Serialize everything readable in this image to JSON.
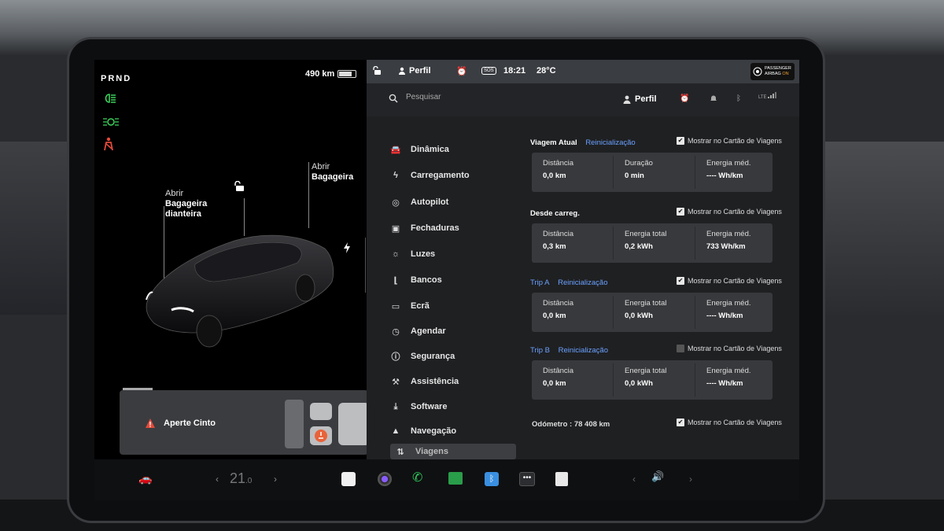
{
  "left": {
    "gear": "PRND",
    "range": "490 km",
    "front_trunk": {
      "action": "Abrir",
      "name": "Bagageira dianteira"
    },
    "rear_trunk": {
      "action": "Abrir",
      "name": "Bagageira"
    },
    "seatbelt_warning": "Aperte Cinto"
  },
  "status": {
    "profile": "Perfil",
    "sos": "SOS",
    "time": "18:21",
    "temperature": "28°C",
    "airbag_line1": "PASSENGER",
    "airbag_line2": "AIRBAG",
    "airbag_state": "ON"
  },
  "search": {
    "placeholder": "Pesquisar"
  },
  "header": {
    "profile": "Perfil",
    "network": "LTE"
  },
  "menu": {
    "items": [
      {
        "label": "Dinâmica",
        "icon": "car-icon"
      },
      {
        "label": "Carregamento",
        "icon": "bolt-icon"
      },
      {
        "label": "Autopilot",
        "icon": "steering-wheel-icon"
      },
      {
        "label": "Fechaduras",
        "icon": "lock-icon"
      },
      {
        "label": "Luzes",
        "icon": "sun-icon"
      },
      {
        "label": "Bancos",
        "icon": "seat-icon"
      },
      {
        "label": "Ecrã",
        "icon": "display-icon"
      },
      {
        "label": "Agendar",
        "icon": "alarm-icon"
      },
      {
        "label": "Segurança",
        "icon": "info-icon"
      },
      {
        "label": "Assistência",
        "icon": "wrench-icon"
      },
      {
        "label": "Software",
        "icon": "download-icon"
      },
      {
        "label": "Navegação",
        "icon": "navigation-icon"
      },
      {
        "label": "Viagens",
        "icon": "trips-icon"
      }
    ]
  },
  "trips": {
    "show_label": "Mostrar no Cartão de Viagens",
    "reset_label": "Reinicialização",
    "current": {
      "title": "Viagem Atual",
      "checked": true,
      "cells": [
        {
          "label": "Distância",
          "value": "0,0  km"
        },
        {
          "label": "Duração",
          "value": "0  min"
        },
        {
          "label": "Energia méd.",
          "value": "----  Wh/km"
        }
      ]
    },
    "since_charge": {
      "title": "Desde carreg.",
      "checked": true,
      "cells": [
        {
          "label": "Distância",
          "value": "0,3  km"
        },
        {
          "label": "Energia total",
          "value": "0,2  kWh"
        },
        {
          "label": "Energia méd.",
          "value": "733  Wh/km"
        }
      ]
    },
    "trip_a": {
      "title": "Trip A",
      "checked": true,
      "cells": [
        {
          "label": "Distância",
          "value": "0,0  km"
        },
        {
          "label": "Energia total",
          "value": "0,0  kWh"
        },
        {
          "label": "Energia méd.",
          "value": "----  Wh/km"
        }
      ]
    },
    "trip_b": {
      "title": "Trip B",
      "checked": false,
      "cells": [
        {
          "label": "Distância",
          "value": "0,0  km"
        },
        {
          "label": "Energia total",
          "value": "0,0  kWh"
        },
        {
          "label": "Energia méd.",
          "value": "----  Wh/km"
        }
      ]
    },
    "odometer": "Odómetro :  78 408  km",
    "odometer_checked": true
  },
  "dock": {
    "temp_whole": "21",
    "temp_decimal": ".0"
  }
}
